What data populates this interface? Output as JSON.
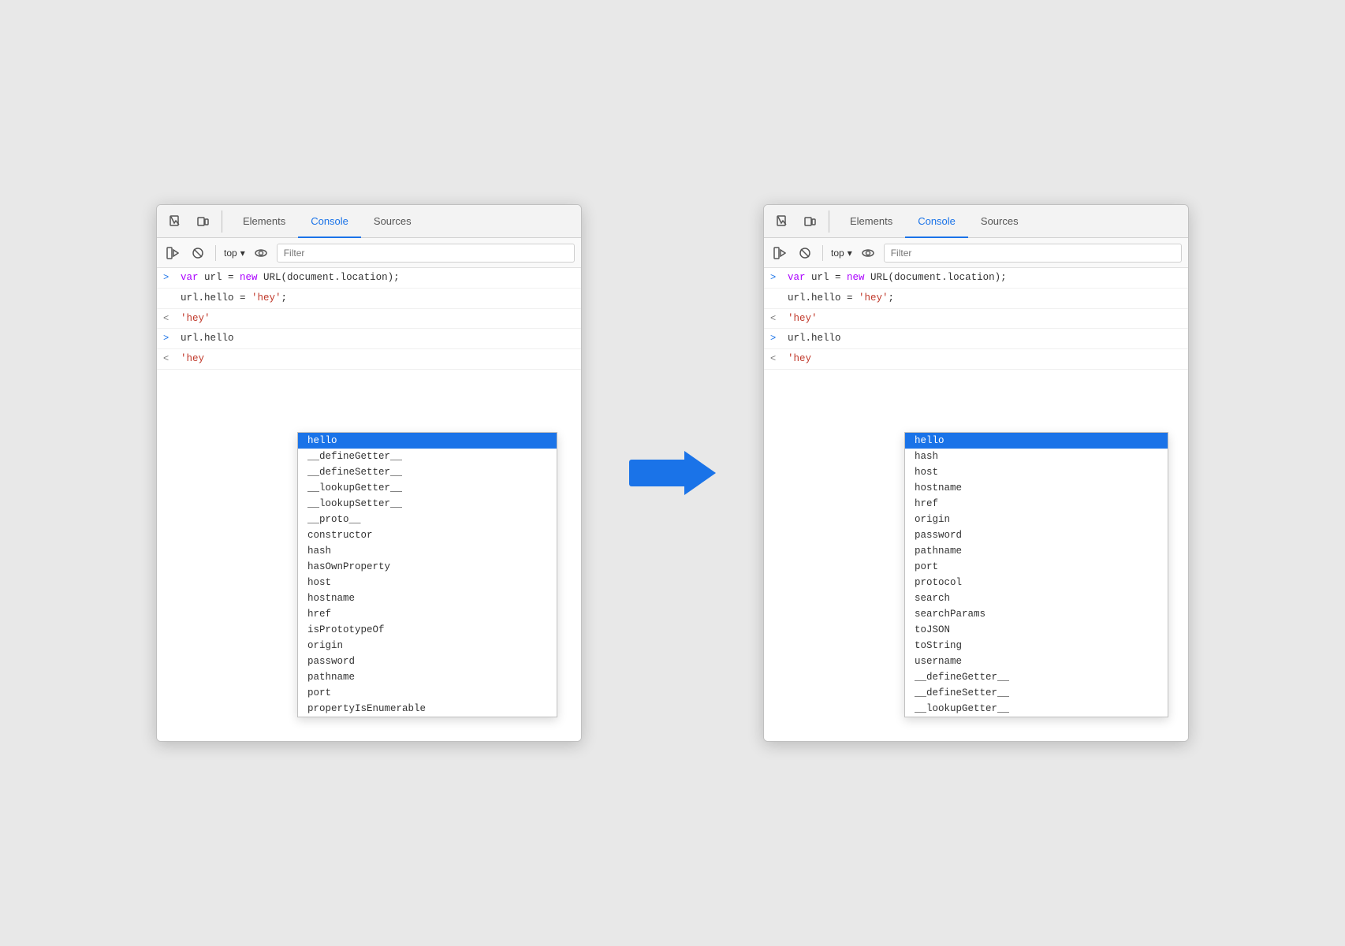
{
  "left_panel": {
    "tabs": [
      "Elements",
      "Console",
      "Sources"
    ],
    "active_tab": "Console",
    "toolbar": {
      "context": "top",
      "filter_placeholder": "Filter"
    },
    "console_lines": [
      {
        "type": "input",
        "prefix": ">",
        "content": "var url = new URL(document.location);"
      },
      {
        "type": "input_cont",
        "prefix": "",
        "content": "url.hello = 'hey';"
      },
      {
        "type": "output",
        "prefix": "<",
        "content": "'hey'"
      },
      {
        "type": "input",
        "prefix": ">",
        "content": "url.hello"
      },
      {
        "type": "output_partial",
        "prefix": "<",
        "content": "'hey"
      }
    ],
    "autocomplete": {
      "selected": "hello",
      "items": [
        "hello",
        "__defineGetter__",
        "__defineSetter__",
        "__lookupGetter__",
        "__lookupSetter__",
        "__proto__",
        "constructor",
        "hash",
        "hasOwnProperty",
        "host",
        "hostname",
        "href",
        "isPrototypeOf",
        "origin",
        "password",
        "pathname",
        "port",
        "propertyIsEnumerable"
      ]
    }
  },
  "right_panel": {
    "tabs": [
      "Elements",
      "Console",
      "Sources"
    ],
    "active_tab": "Console",
    "toolbar": {
      "context": "top",
      "filter_placeholder": "Filter"
    },
    "console_lines": [
      {
        "type": "input",
        "prefix": ">",
        "content": "var url = new URL(document.location);"
      },
      {
        "type": "input_cont",
        "prefix": "",
        "content": "url.hello = 'hey';"
      },
      {
        "type": "output",
        "prefix": "<",
        "content": "'hey'"
      },
      {
        "type": "input",
        "prefix": ">",
        "content": "url.hello"
      },
      {
        "type": "output_partial",
        "prefix": "<",
        "content": "'hey"
      }
    ],
    "autocomplete": {
      "selected": "hello",
      "items": [
        "hello",
        "hash",
        "host",
        "hostname",
        "href",
        "origin",
        "password",
        "pathname",
        "port",
        "protocol",
        "search",
        "searchParams",
        "toJSON",
        "toString",
        "username",
        "__defineGetter__",
        "__defineSetter__",
        "__lookupGetter__"
      ]
    }
  },
  "arrow": {
    "color": "#1a73e8"
  }
}
